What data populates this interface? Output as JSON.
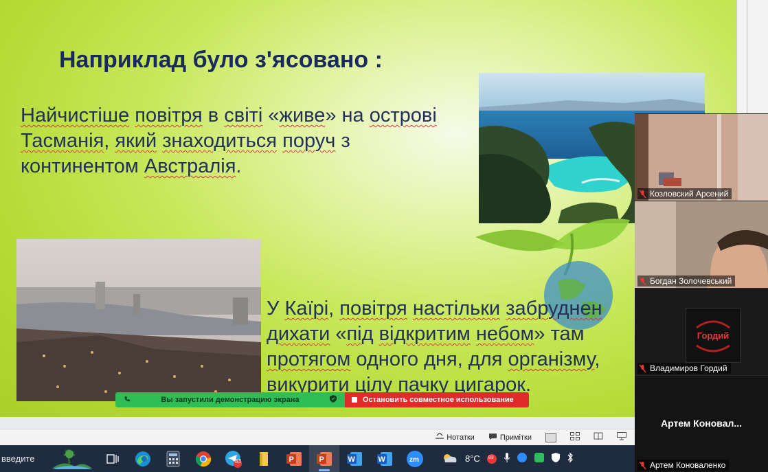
{
  "slide": {
    "title": "Наприклад було з'ясовано :",
    "para1": {
      "lines": [
        [
          {
            "t": "Найчистіше",
            "u": true
          },
          {
            "t": " "
          },
          {
            "t": "повітря",
            "u": true
          },
          {
            "t": " в "
          },
          {
            "t": "світі",
            "u": true
          },
          {
            "t": " «"
          },
          {
            "t": "живе",
            "u": true
          },
          {
            "t": "» на "
          },
          {
            "t": "острові",
            "u": true
          }
        ],
        [
          {
            "t": "Тасманія",
            "u": true
          },
          {
            "t": ", "
          },
          {
            "t": "який",
            "u": true
          },
          {
            "t": " "
          },
          {
            "t": "знаходиться",
            "u": true
          },
          {
            "t": " "
          },
          {
            "t": "поруч",
            "u": true
          },
          {
            "t": " з"
          }
        ],
        [
          {
            "t": "континентом",
            "u": false
          },
          {
            "t": " "
          },
          {
            "t": "Австралія",
            "u": true
          },
          {
            "t": "."
          }
        ]
      ]
    },
    "para2": {
      "lines": [
        [
          {
            "t": " У "
          },
          {
            "t": "Каїрі",
            "u": true
          },
          {
            "t": ", "
          },
          {
            "t": "повітря",
            "u": true
          },
          {
            "t": " "
          },
          {
            "t": "настільки",
            "u": true
          },
          {
            "t": " "
          },
          {
            "t": "забруднен",
            "u": true
          }
        ],
        [
          {
            "t": "дихати",
            "u": true
          },
          {
            "t": " «"
          },
          {
            "t": "під",
            "u": true
          },
          {
            "t": " "
          },
          {
            "t": "відкритим",
            "u": true
          },
          {
            "t": " "
          },
          {
            "t": "небом",
            "u": true
          },
          {
            "t": "» там"
          }
        ],
        [
          {
            "t": "протягом",
            "u": true
          },
          {
            "t": " одного дня, для "
          },
          {
            "t": "організму",
            "u": true
          },
          {
            "t": ","
          }
        ],
        [
          {
            "t": "викурити",
            "u": true
          },
          {
            "t": " "
          },
          {
            "t": "цілу",
            "u": true
          },
          {
            "t": " "
          },
          {
            "t": "пачку",
            "u": true
          },
          {
            "t": " "
          },
          {
            "t": "цигарок",
            "u": true
          },
          {
            "t": "."
          }
        ]
      ]
    }
  },
  "share_banner": {
    "status_text": "Вы запустили демонстрацию экрана",
    "stop_label": "Остановить совместное использование"
  },
  "statusbar": {
    "notes_label": "Нотатки",
    "comments_label": "Примітки"
  },
  "taskbar": {
    "search_text": "введите",
    "weather_temp": "8°C",
    "telegram_badge": "83",
    "tray_badge": "83",
    "apps": [
      "task-view-icon",
      "edge-icon",
      "calculator-icon",
      "chrome-icon",
      "telegram-icon",
      "file-explorer-icon",
      "powerpoint-icon",
      "powerpoint-active-icon",
      "word-icon",
      "word-2-icon",
      "zoom-icon"
    ]
  },
  "zoom": {
    "participants": [
      {
        "name": "Козловский Арсений"
      },
      {
        "name": "Богдан Золочевський"
      },
      {
        "name": "Владимиров Гордий",
        "avatar_text": "Гордий"
      },
      {
        "name": "Артем Коноваленко",
        "display": "Артем  Коновал..."
      }
    ]
  },
  "colors": {
    "title": "#1b2a5c",
    "share_green": "#2fbe55",
    "share_red": "#e02b2b",
    "taskbar": "#1f2b3e"
  }
}
